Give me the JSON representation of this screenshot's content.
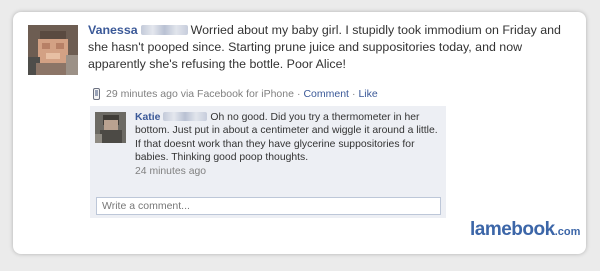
{
  "post": {
    "author": "Vanessa",
    "text": "Worried about my baby girl. I stupidly took immodium on Friday and she hasn't pooped since. Starting prune juice and suppositories today, and now apparently she's refusing the bottle. Poor Alice!",
    "time_source": "29 minutes ago via Facebook for iPhone",
    "separator": "·",
    "comment_link": "Comment",
    "like_link": "Like",
    "source_icon": "phone-icon"
  },
  "comment": {
    "author": "Katie",
    "text": "Oh no good. Did you try a thermometer in her bottom. Just put in about a centimeter and wiggle it around a little. If that doesnt work than they have glycerine suppositories for babies. Thinking good poop thoughts.",
    "time": "24 minutes ago"
  },
  "comment_box": {
    "placeholder": "Write a comment..."
  },
  "watermark": {
    "main": "lamebook",
    "suffix": ".com"
  },
  "colors": {
    "link": "#3b5998",
    "comment_bg": "#edeff4",
    "page_bg": "#ebebeb"
  }
}
